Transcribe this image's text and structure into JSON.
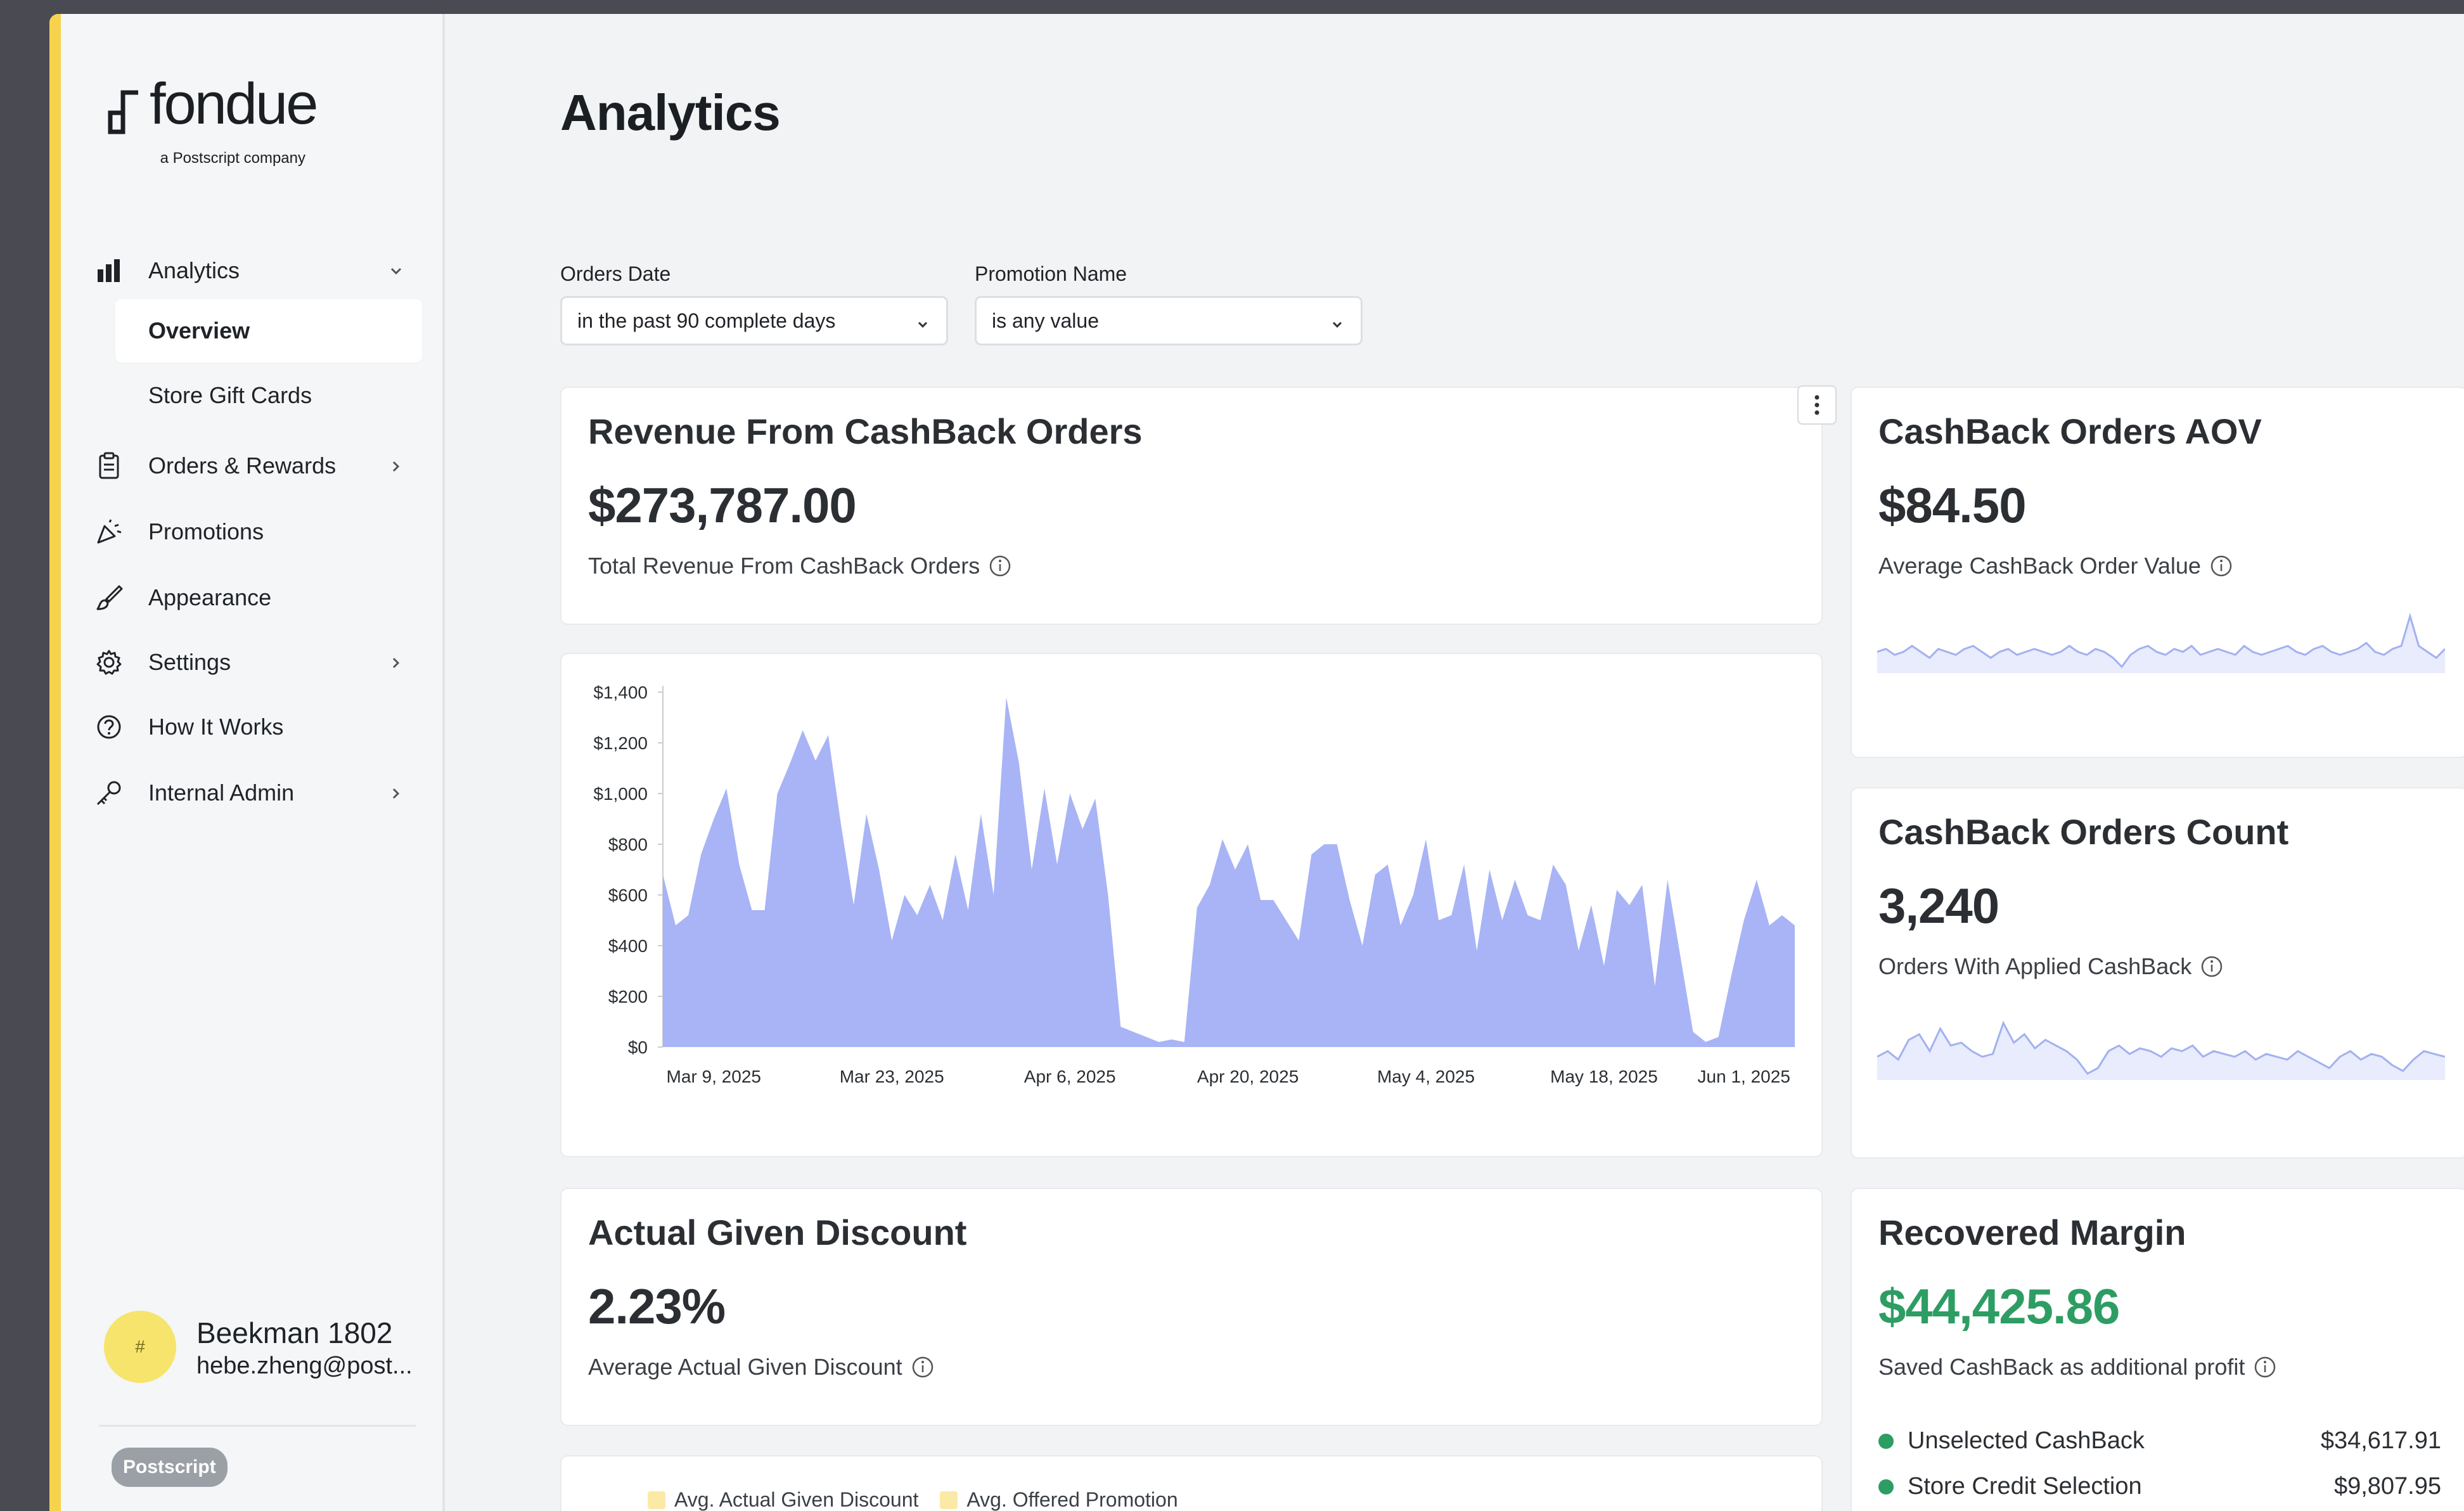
{
  "brand": {
    "name": "fondue",
    "tagline": "a Postscript company"
  },
  "sidebar": {
    "nav": {
      "analytics": "Analytics",
      "overview": "Overview",
      "store_gift_cards": "Store Gift Cards",
      "orders_rewards": "Orders & Rewards",
      "promotions": "Promotions",
      "appearance": "Appearance",
      "settings": "Settings",
      "how_it_works": "How It Works",
      "internal_admin": "Internal Admin"
    },
    "account": {
      "name": "Beekman 1802",
      "email": "hebe.zheng@post..."
    },
    "badge": "Postscript"
  },
  "page": {
    "title": "Analytics"
  },
  "filters": {
    "orders_date": {
      "label": "Orders Date",
      "value": "in the past 90 complete days"
    },
    "promotion_name": {
      "label": "Promotion Name",
      "value": "is any value"
    }
  },
  "cards": {
    "revenue": {
      "title": "Revenue From CashBack Orders",
      "value": "$273,787.00",
      "subtitle": "Total Revenue From CashBack Orders"
    },
    "aov": {
      "title": "CashBack Orders AOV",
      "value": "$84.50",
      "subtitle": "Average CashBack Order Value"
    },
    "count": {
      "title": "CashBack Orders Count",
      "value": "3,240",
      "subtitle": "Orders With Applied CashBack"
    },
    "discount": {
      "title": "Actual Given Discount",
      "value": "2.23%",
      "subtitle": "Average Actual Given Discount"
    },
    "recovered": {
      "title": "Recovered Margin",
      "value": "$44,425.86",
      "value_color": "#2d9d63",
      "subtitle": "Saved CashBack as additional profit",
      "rows": [
        {
          "label": "Unselected CashBack",
          "value": "$34,617.91"
        },
        {
          "label": "Store Credit Selection",
          "value": "$9,807.95"
        }
      ]
    },
    "discount_chart": {
      "legend": [
        "Avg. Actual Given Discount",
        "Avg. Offered Promotion"
      ]
    }
  },
  "colors": {
    "accent": "#f7d24c",
    "area_fill": "#a8b4f5",
    "sparkline": "#a3b1f0",
    "positive": "#2d9d63"
  },
  "chart_data": [
    {
      "type": "area",
      "ylabel": "",
      "xlabel": "",
      "ylim": [
        0,
        1400
      ],
      "yticks": [
        "$0",
        "$200",
        "$400",
        "$600",
        "$800",
        "$1,000",
        "$1,200",
        "$1,400"
      ],
      "ytick_values": [
        0,
        200,
        400,
        600,
        800,
        1000,
        1200,
        1400
      ],
      "xticks": [
        "Mar 9, 2025",
        "Mar 23, 2025",
        "Apr 6, 2025",
        "Apr 20, 2025",
        "May 4, 2025",
        "May 18, 2025",
        "Jun 1, 2025"
      ],
      "xtick_days": [
        4,
        18,
        32,
        46,
        60,
        74,
        85
      ],
      "x_days": [
        0,
        1,
        2,
        3,
        4,
        5,
        6,
        7,
        8,
        9,
        10,
        11,
        12,
        13,
        14,
        15,
        16,
        17,
        18,
        19,
        20,
        21,
        22,
        23,
        24,
        25,
        26,
        27,
        28,
        29,
        30,
        31,
        32,
        33,
        34,
        35,
        36,
        37,
        38,
        39,
        40,
        41,
        42,
        43,
        44,
        45,
        46,
        47,
        48,
        49,
        50,
        51,
        52,
        53,
        54,
        55,
        56,
        57,
        58,
        59,
        60,
        61,
        62,
        63,
        64,
        65,
        66,
        67,
        68,
        69,
        70,
        71,
        72,
        73,
        74,
        75,
        76,
        77,
        78,
        79,
        80,
        81,
        82,
        83,
        84,
        85,
        86,
        87,
        88,
        89
      ],
      "values": [
        680,
        480,
        520,
        760,
        900,
        1020,
        720,
        540,
        540,
        1000,
        1120,
        1250,
        1130,
        1230,
        880,
        560,
        920,
        700,
        420,
        600,
        520,
        640,
        500,
        760,
        540,
        920,
        600,
        1380,
        1120,
        700,
        1020,
        720,
        1000,
        860,
        980,
        600,
        80,
        60,
        40,
        20,
        30,
        20,
        550,
        640,
        820,
        700,
        800,
        580,
        580,
        500,
        420,
        760,
        800,
        800,
        580,
        400,
        680,
        720,
        480,
        600,
        820,
        500,
        520,
        720,
        380,
        700,
        500,
        660,
        520,
        500,
        720,
        640,
        380,
        560,
        320,
        620,
        560,
        640,
        240,
        660,
        360,
        60,
        20,
        40,
        280,
        500,
        660,
        480,
        520,
        480
      ]
    },
    {
      "type": "line",
      "title": "",
      "values": [
        50,
        51,
        49,
        50,
        52,
        50,
        48,
        51,
        50,
        49,
        51,
        52,
        50,
        48,
        50,
        51,
        49,
        50,
        51,
        50,
        49,
        50,
        52,
        50,
        49,
        51,
        50,
        48,
        45,
        49,
        51,
        52,
        50,
        49,
        51,
        50,
        52,
        49,
        50,
        51,
        50,
        49,
        52,
        50,
        49,
        50,
        51,
        52,
        50,
        49,
        51,
        52,
        50,
        49,
        50,
        51,
        53,
        50,
        49,
        51,
        52,
        62,
        52,
        50,
        48,
        51
      ]
    },
    {
      "type": "line",
      "title": "",
      "values": [
        50,
        52,
        49,
        56,
        58,
        52,
        60,
        54,
        55,
        52,
        50,
        51,
        62,
        55,
        58,
        53,
        56,
        54,
        52,
        49,
        44,
        46,
        52,
        54,
        51,
        53,
        52,
        50,
        53,
        52,
        54,
        50,
        52,
        51,
        50,
        52,
        49,
        51,
        50,
        49,
        52,
        50,
        48,
        46,
        50,
        52,
        49,
        51,
        50,
        47,
        45,
        49,
        52,
        51,
        50
      ]
    }
  ]
}
